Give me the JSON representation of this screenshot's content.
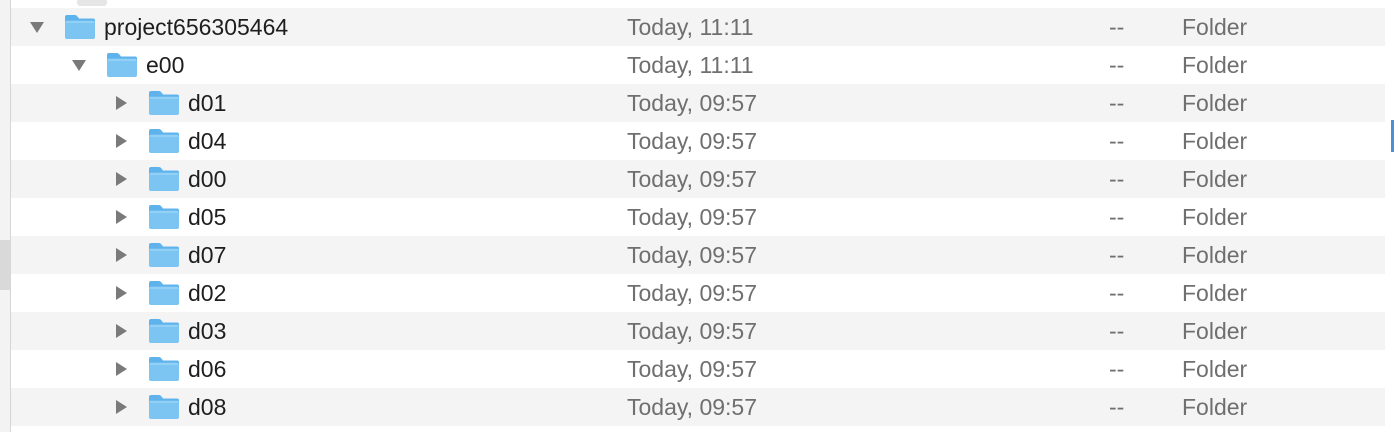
{
  "colors": {
    "row_alt": "#f4f4f4",
    "row": "#ffffff",
    "folder_fill": "#7cc4f2",
    "folder_tab": "#5fb3ec",
    "text_primary": "#1e1e1e",
    "text_secondary": "#6f6f6f",
    "disclosure": "#7a7a7a"
  },
  "rows": [
    {
      "name": "project656305464",
      "date": "Today, 11:11",
      "size": "--",
      "kind": "Folder",
      "expanded": true,
      "level": 0
    },
    {
      "name": "e00",
      "date": "Today, 11:11",
      "size": "--",
      "kind": "Folder",
      "expanded": true,
      "level": 1
    },
    {
      "name": "d01",
      "date": "Today, 09:57",
      "size": "--",
      "kind": "Folder",
      "expanded": false,
      "level": 2
    },
    {
      "name": "d04",
      "date": "Today, 09:57",
      "size": "--",
      "kind": "Folder",
      "expanded": false,
      "level": 2
    },
    {
      "name": "d00",
      "date": "Today, 09:57",
      "size": "--",
      "kind": "Folder",
      "expanded": false,
      "level": 2
    },
    {
      "name": "d05",
      "date": "Today, 09:57",
      "size": "--",
      "kind": "Folder",
      "expanded": false,
      "level": 2
    },
    {
      "name": "d07",
      "date": "Today, 09:57",
      "size": "--",
      "kind": "Folder",
      "expanded": false,
      "level": 2
    },
    {
      "name": "d02",
      "date": "Today, 09:57",
      "size": "--",
      "kind": "Folder",
      "expanded": false,
      "level": 2
    },
    {
      "name": "d03",
      "date": "Today, 09:57",
      "size": "--",
      "kind": "Folder",
      "expanded": false,
      "level": 2
    },
    {
      "name": "d06",
      "date": "Today, 09:57",
      "size": "--",
      "kind": "Folder",
      "expanded": false,
      "level": 2
    },
    {
      "name": "d08",
      "date": "Today, 09:57",
      "size": "--",
      "kind": "Folder",
      "expanded": false,
      "level": 2
    }
  ]
}
